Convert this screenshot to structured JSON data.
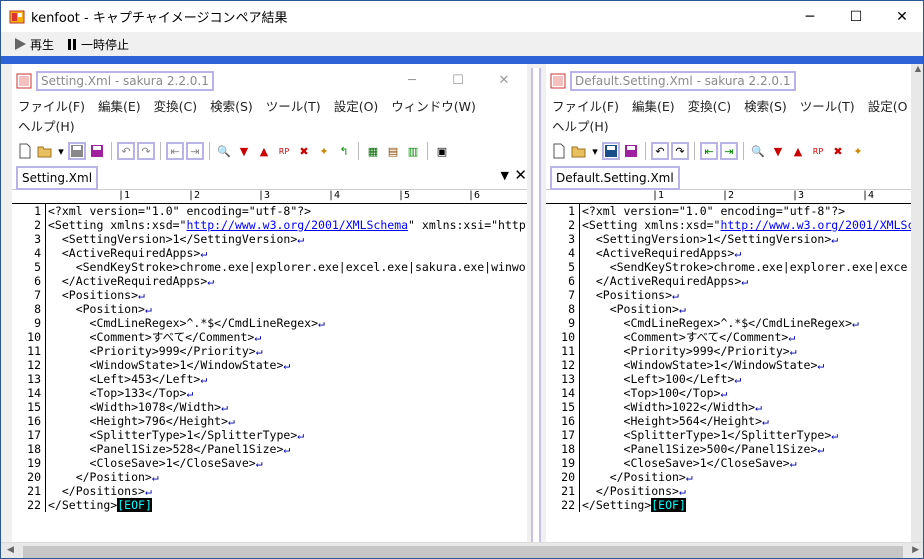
{
  "window": {
    "title": "kenfoot - キャプチャイメージコンペア結果",
    "minimize": "─",
    "maximize": "☐",
    "close": "✕"
  },
  "toolbar": {
    "play_label": "再生",
    "pause_label": "一時停止"
  },
  "left_pane": {
    "title": "Setting.Xml - sakura 2.2.0.1",
    "menu": [
      "ファイル(F)",
      "編集(E)",
      "変換(C)",
      "検索(S)",
      "ツール(T)",
      "設定(O)",
      "ウィンドウ(W)",
      "ヘルプ(H)"
    ],
    "tab": "Setting.Xml",
    "ruler": [
      "1",
      "2",
      "3",
      "4",
      "5",
      "6"
    ],
    "lines": [
      "<?xml version=\"1.0\" encoding=\"utf-8\"?>",
      "<Setting xmlns:xsd=\"http://www.w3.org/2001/XMLSchema\" xmlns:xsi=\"http",
      "  <SettingVersion>1</SettingVersion>↵",
      "  <ActiveRequiredApps>↵",
      "    <SendKeyStroke>chrome.exe|explorer.exe|excel.exe|sakura.exe|winwo",
      "  </ActiveRequiredApps>↵",
      "  <Positions>↵",
      "    <Position>↵",
      "      <CmdLineRegex>^.*$</CmdLineRegex>↵",
      "      <Comment>すべて</Comment>↵",
      "      <Priority>999</Priority>↵",
      "      <WindowState>1</WindowState>↵",
      "      <Left>453</Left>↵",
      "      <Top>133</Top>↵",
      "      <Width>1078</Width>↵",
      "      <Height>796</Height>↵",
      "      <SplitterType>1</SplitterType>↵",
      "      <Panel1Size>528</Panel1Size>↵",
      "      <CloseSave>1</CloseSave>↵",
      "    </Position>↵",
      "  </Positions>↵",
      "</Setting>"
    ]
  },
  "right_pane": {
    "title": "Default.Setting.Xml - sakura 2.2.0.1",
    "menu": [
      "ファイル(F)",
      "編集(E)",
      "変換(C)",
      "検索(S)",
      "ツール(T)",
      "設定(O",
      "ヘルプ(H)"
    ],
    "tab": "Default.Setting.Xml",
    "ruler": [
      "1",
      "2",
      "3",
      "4"
    ],
    "lines": [
      "<?xml version=\"1.0\" encoding=\"utf-8\"?>",
      "<Setting xmlns:xsd=\"http://www.w3.org/2001/XMLSc",
      "  <SettingVersion>1</SettingVersion>↵",
      "  <ActiveRequiredApps>↵",
      "    <SendKeyStroke>chrome.exe|explorer.exe|exce",
      "  </ActiveRequiredApps>↵",
      "  <Positions>↵",
      "    <Position>↵",
      "      <CmdLineRegex>^.*$</CmdLineRegex>↵",
      "      <Comment>すべて</Comment>↵",
      "      <Priority>999</Priority>↵",
      "      <WindowState>1</WindowState>↵",
      "      <Left>100</Left>↵",
      "      <Top>100</Top>↵",
      "      <Width>1022</Width>↵",
      "      <Height>564</Height>↵",
      "      <SplitterType>1</SplitterType>↵",
      "      <Panel1Size>500</Panel1Size>↵",
      "      <CloseSave>1</CloseSave>↵",
      "    </Position>↵",
      "  </Positions>↵",
      "</Setting>"
    ]
  },
  "eof_label": "[EOF]",
  "colors": {
    "accent": "#2e63d8",
    "highlight": "#b8b4e8"
  }
}
